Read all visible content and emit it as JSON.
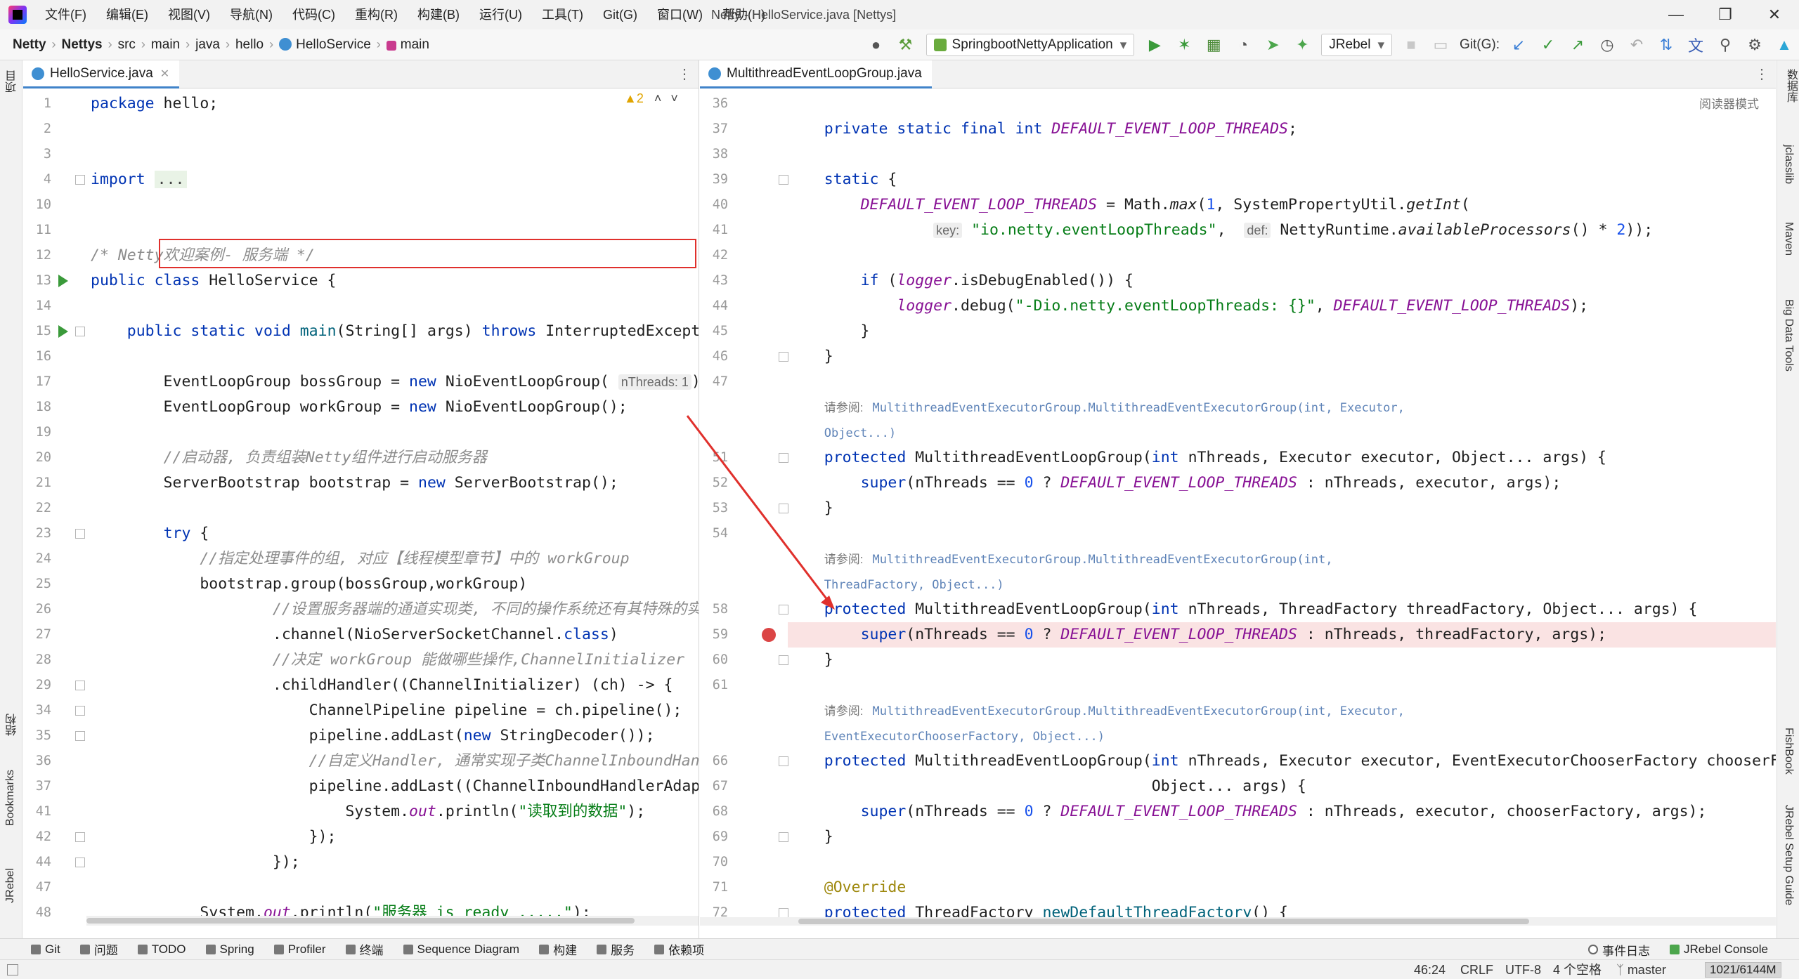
{
  "menu": [
    "文件(F)",
    "编辑(E)",
    "视图(V)",
    "导航(N)",
    "代码(C)",
    "重构(R)",
    "构建(B)",
    "运行(U)",
    "工具(T)",
    "Git(G)",
    "窗口(W)",
    "帮助(H)"
  ],
  "window_title": "Netty - HelloService.java [Nettys]",
  "breadcrumb": [
    "Netty",
    "Nettys",
    "src",
    "main",
    "java",
    "hello",
    "HelloService",
    "main"
  ],
  "toolbar": {
    "run_config": "SpringbootNettyApplication",
    "jrebel": "JRebel",
    "git_label": "Git(G):"
  },
  "left_strip": [
    "项目",
    "结构",
    "Bookmarks",
    "JRebel"
  ],
  "right_strip": [
    "数据库",
    "jclasslib",
    "Maven",
    "Big Data Tools",
    "FishBook",
    "JRebel Setup Guide"
  ],
  "left_editor": {
    "tab": "HelloService.java",
    "warnings": "▲2",
    "lines": [
      {
        "n": "1",
        "html": "<span class='kw'>package</span> hello;"
      },
      {
        "n": "2",
        "html": ""
      },
      {
        "n": "3",
        "html": ""
      },
      {
        "n": "4",
        "html": "<span class='kw'>import</span> <span class='fold-box'>...</span>"
      },
      {
        "n": "10",
        "html": ""
      },
      {
        "n": "11",
        "html": ""
      },
      {
        "n": "12",
        "html": "<span class='cm'>/* Netty欢迎案例- 服务端 */</span>"
      },
      {
        "n": "13",
        "html": "<span class='kw'>public class</span> HelloService {"
      },
      {
        "n": "14",
        "html": ""
      },
      {
        "n": "15",
        "html": "    <span class='kw'>public static void</span> <span class='mth'>main</span>(String[] args) <span class='kw'>throws</span> InterruptedException {"
      },
      {
        "n": "16",
        "html": ""
      },
      {
        "n": "17",
        "html": "        EventLoopGroup bossGroup = <span class='kw'>new</span> NioEventLoopGroup( <span class='hint'>nThreads: 1</span>);"
      },
      {
        "n": "18",
        "html": "        EventLoopGroup workGroup = <span class='kw'>new</span> NioEventLoopGroup();"
      },
      {
        "n": "19",
        "html": ""
      },
      {
        "n": "20",
        "html": "        <span class='cm'>//启动器, 负责组装Netty组件进行启动服务器</span>"
      },
      {
        "n": "21",
        "html": "        ServerBootstrap bootstrap = <span class='kw'>new</span> ServerBootstrap();"
      },
      {
        "n": "22",
        "html": ""
      },
      {
        "n": "23",
        "html": "        <span class='kw'>try</span> {"
      },
      {
        "n": "24",
        "html": "            <span class='cm'>//指定处理事件的组, 对应【线程模型章节】中的 workGroup</span>"
      },
      {
        "n": "25",
        "html": "            bootstrap.group(bossGroup,workGroup)"
      },
      {
        "n": "26",
        "html": "                    <span class='cm'>//设置服务器端的通道实现类, 不同的操作系统还有其特殊的实现</span>"
      },
      {
        "n": "27",
        "html": "                    .channel(NioServerSocketChannel.<span class='kw'>class</span>)"
      },
      {
        "n": "28",
        "html": "                    <span class='cm'>//决定 workGroup 能做哪些操作,ChannelInitializer</span>"
      },
      {
        "n": "29",
        "html": "                    .childHandler((ChannelInitializer) (ch) -> {"
      },
      {
        "n": "34",
        "html": "                        ChannelPipeline pipeline = ch.pipeline();"
      },
      {
        "n": "35",
        "html": "                        pipeline.addLast(<span class='kw'>new</span> StringDecoder());"
      },
      {
        "n": "36",
        "html": "                        <span class='cm'>//自定义Handler, 通常实现子类ChannelInboundHandlerAdapter</span>"
      },
      {
        "n": "37",
        "html": "                        pipeline.addLast((ChannelInboundHandlerAdapter) {"
      },
      {
        "n": "41",
        "html": "                            System.<span class='fld'>out</span>.println(<span class='st'>\"读取到的数据\"</span>);"
      },
      {
        "n": "42",
        "html": "                        });"
      },
      {
        "n": "44",
        "html": "                    });"
      },
      {
        "n": "47",
        "html": ""
      },
      {
        "n": "48",
        "html": "            System.<span class='fld'>out</span>.println(<span class='st'>\"服务器 is ready .....\"</span>);"
      }
    ]
  },
  "right_editor": {
    "tab": "MultithreadEventLoopGroup.java",
    "reader_mode": "阅读器模式",
    "lines": [
      {
        "n": "36",
        "html": ""
      },
      {
        "n": "37",
        "html": "    <span class='kw'>private static final int</span> <span class='fld'>DEFAULT_EVENT_LOOP_THREADS</span>;"
      },
      {
        "n": "38",
        "html": ""
      },
      {
        "n": "39",
        "html": "    <span class='kw'>static</span> {"
      },
      {
        "n": "40",
        "html": "        <span class='fld'>DEFAULT_EVENT_LOOP_THREADS</span> = Math.<span class='it'>max</span>(<span class='nm'>1</span>, SystemPropertyUtil.<span class='it'>getInt</span>("
      },
      {
        "n": "41",
        "html": "                <span class='hint'>key:</span> <span class='st'>\"io.netty.eventLoopThreads\"</span>,  <span class='hint'>def:</span> NettyRuntime.<span class='it'>availableProcessors</span>() * <span class='nm'>2</span>));"
      },
      {
        "n": "42",
        "html": ""
      },
      {
        "n": "43",
        "html": "        <span class='kw'>if</span> (<span class='fld'>logger</span>.isDebugEnabled()) {"
      },
      {
        "n": "44",
        "html": "            <span class='fld'>logger</span>.debug(<span class='st'>\"-Dio.netty.eventLoopThreads: {}\"</span>, <span class='fld'>DEFAULT_EVENT_LOOP_THREADS</span>);"
      },
      {
        "n": "45",
        "html": "        }"
      },
      {
        "n": "46",
        "html": "    }"
      },
      {
        "n": "47",
        "html": ""
      },
      {
        "n": "",
        "html": "    <span class='doc-label'>请参阅:</span> <span class='doc-ref'>MultithreadEventExecutorGroup.MultithreadEventExecutorGroup(int, Executor,</span>"
      },
      {
        "n": "",
        "html": "    <span class='doc-ref'>Object...)</span>"
      },
      {
        "n": "51",
        "html": "    <span class='kw'>protected</span> MultithreadEventLoopGroup(<span class='kw'>int</span> nThreads, Executor executor, Object... args) {"
      },
      {
        "n": "52",
        "html": "        <span class='kw'>super</span>(nThreads == <span class='nm'>0</span> ? <span class='fld'>DEFAULT_EVENT_LOOP_THREADS</span> : nThreads, executor, args);"
      },
      {
        "n": "53",
        "html": "    }"
      },
      {
        "n": "54",
        "html": ""
      },
      {
        "n": "",
        "html": "    <span class='doc-label'>请参阅:</span> <span class='doc-ref'>MultithreadEventExecutorGroup.MultithreadEventExecutorGroup(int,</span>"
      },
      {
        "n": "",
        "html": "    <span class='doc-ref'>ThreadFactory, Object...)</span>"
      },
      {
        "n": "58",
        "html": "    <span class='kw'>protected</span> MultithreadEventLoopGroup(<span class='kw'>int</span> nThreads, ThreadFactory threadFactory, Object... args) {"
      },
      {
        "n": "59",
        "html": "        <span class='kw'>super</span>(nThreads == <span class='nm'>0</span> ? <span class='fld'>DEFAULT_EVENT_LOOP_THREADS</span> : nThreads, threadFactory, args);"
      },
      {
        "n": "60",
        "html": "    }"
      },
      {
        "n": "61",
        "html": ""
      },
      {
        "n": "",
        "html": "    <span class='doc-label'>请参阅:</span> <span class='doc-ref'>MultithreadEventExecutorGroup.MultithreadEventExecutorGroup(int, Executor,</span>"
      },
      {
        "n": "",
        "html": "    <span class='doc-ref'>EventExecutorChooserFactory, Object...)</span>"
      },
      {
        "n": "66",
        "html": "    <span class='kw'>protected</span> MultithreadEventLoopGroup(<span class='kw'>int</span> nThreads, Executor executor, EventExecutorChooserFactory chooserFactory,"
      },
      {
        "n": "67",
        "html": "                                        Object... args) {"
      },
      {
        "n": "68",
        "html": "        <span class='kw'>super</span>(nThreads == <span class='nm'>0</span> ? <span class='fld'>DEFAULT_EVENT_LOOP_THREADS</span> : nThreads, executor, chooserFactory, args);"
      },
      {
        "n": "69",
        "html": "    }"
      },
      {
        "n": "70",
        "html": ""
      },
      {
        "n": "71",
        "html": "    <span style='color:#9e880d'>@Override</span>"
      },
      {
        "n": "72",
        "html": "    <span class='kw'>protected</span> ThreadFactory <span class='mth'>newDefaultThreadFactory</span>() {"
      }
    ]
  },
  "bottom_tools": [
    "Git",
    "问题",
    "TODO",
    "Spring",
    "Profiler",
    "终端",
    "Sequence Diagram",
    "构建",
    "服务",
    "依赖项"
  ],
  "bottom_right": [
    "事件日志",
    "JRebel Console"
  ],
  "status": {
    "position": "46:24",
    "line_sep": "CRLF",
    "encoding": "UTF-8",
    "indent": "4 个空格",
    "branch": "master",
    "memory": "1021/6144M"
  }
}
